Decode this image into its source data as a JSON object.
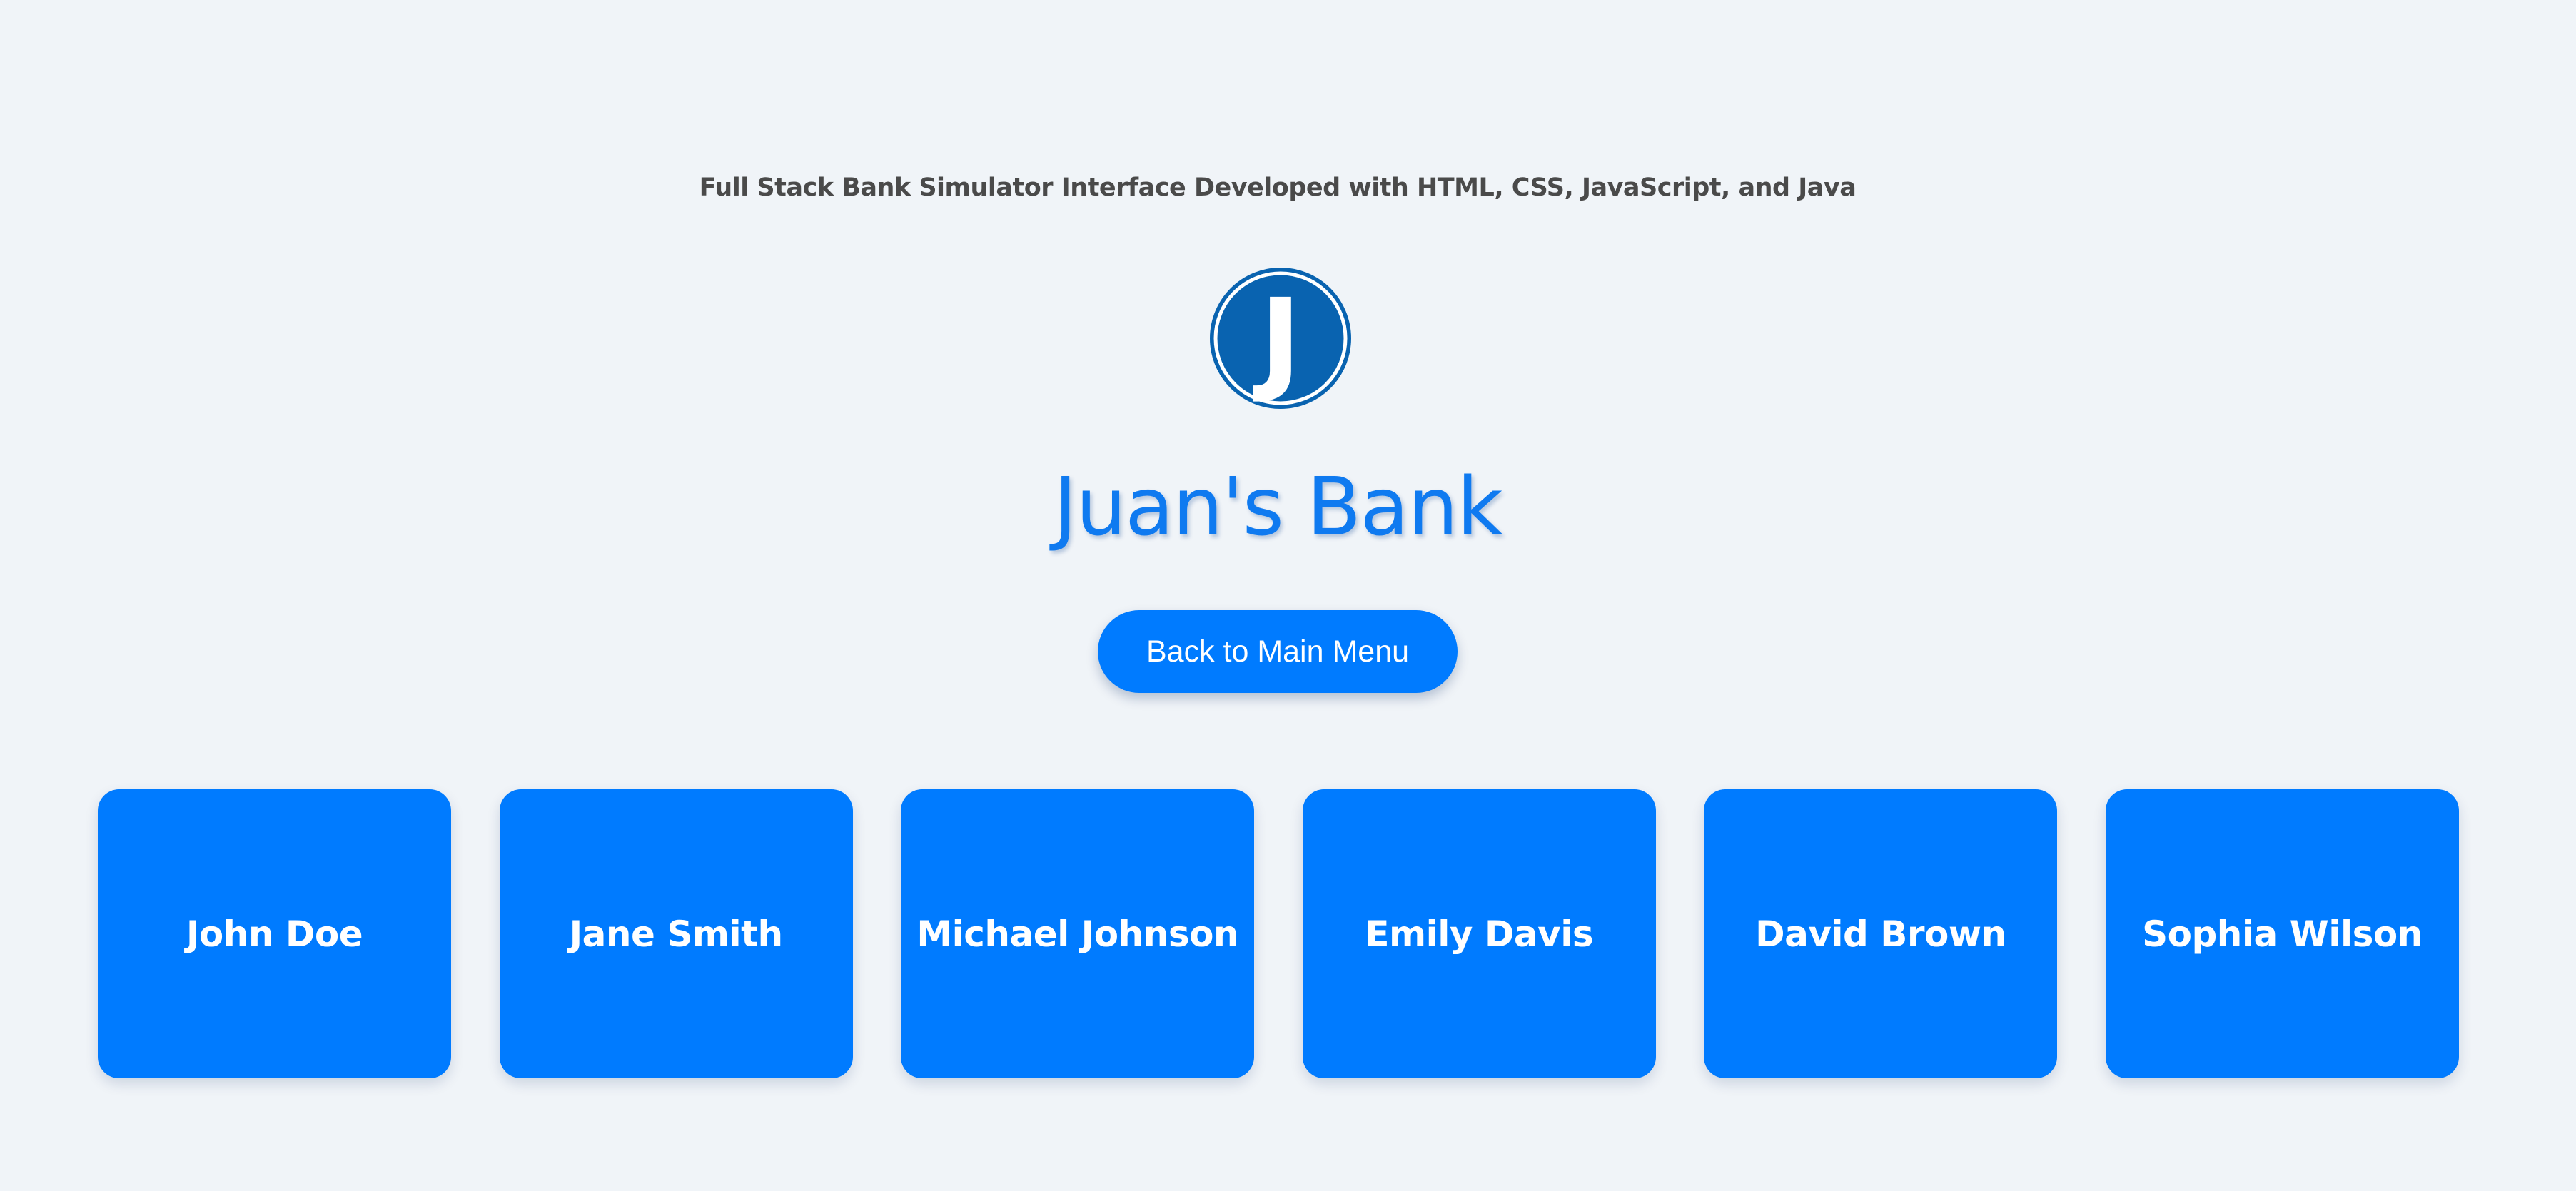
{
  "header": {
    "subtitle": "Full Stack Bank Simulator Interface Developed with HTML, CSS, JavaScript, and Java",
    "logo_letter": "J",
    "logo_icon": "bank-logo-icon",
    "title": "Juan's Bank"
  },
  "actions": {
    "back_label": "Back to Main Menu"
  },
  "customers": [
    {
      "name": "John Doe"
    },
    {
      "name": "Jane Smith"
    },
    {
      "name": "Michael Johnson"
    },
    {
      "name": "Emily Davis"
    },
    {
      "name": "David Brown"
    },
    {
      "name": "Sophia Wilson"
    }
  ],
  "colors": {
    "background": "#f0f4f8",
    "primary": "#007bff",
    "title": "#0f7af0",
    "logo": "#0963b0",
    "subtitle": "#4a4a4a"
  }
}
